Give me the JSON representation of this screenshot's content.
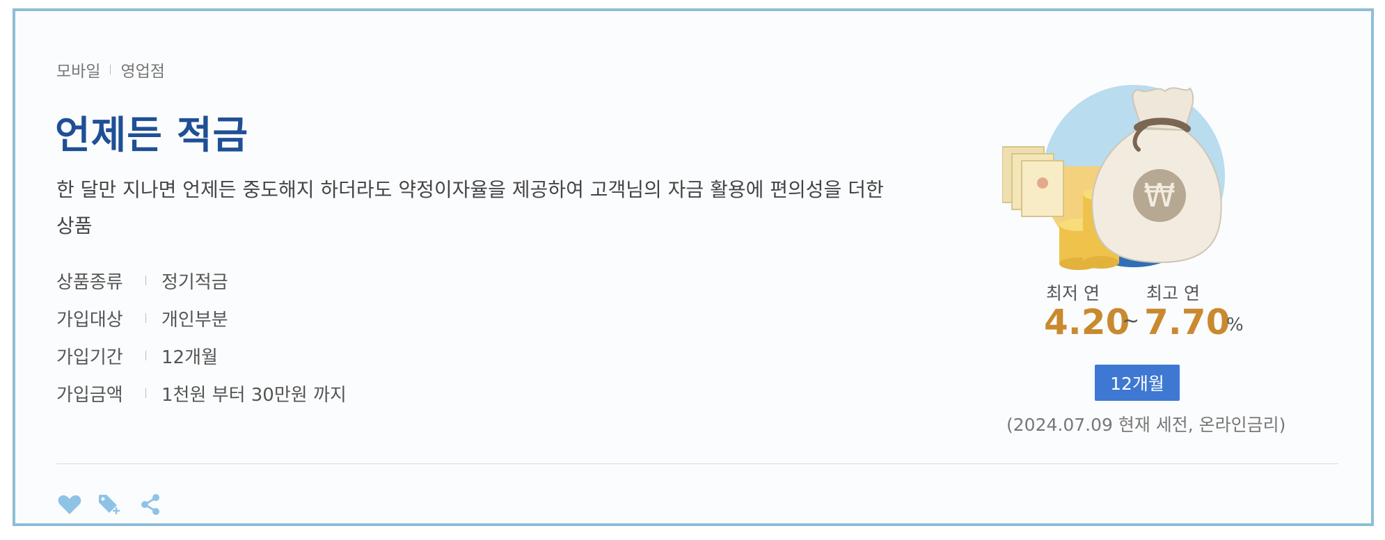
{
  "product": {
    "channels": [
      "모바일",
      "영업점"
    ],
    "title": "언제든 적금",
    "description": "한 달만 지나면 언제든 중도해지 하더라도 약정이자율을 제공하여 고객님의 자금 활용에 편의성을 더한 상품",
    "specs": [
      {
        "label": "상품종류",
        "value": "정기적금"
      },
      {
        "label": "가입대상",
        "value": "개인부분"
      },
      {
        "label": "가입기간",
        "value": "12개월"
      },
      {
        "label": "가입금액",
        "value": "1천원 부터 30만원 까지"
      }
    ]
  },
  "rates": {
    "min_label": "최저 연",
    "min_value": "4.20",
    "separator": "~",
    "max_label": "최고 연",
    "max_value": "7.70",
    "unit": "%",
    "term_badge": "12개월",
    "note": "(2024.07.09 현재 세전, 온라인금리)"
  },
  "actions": [
    {
      "icon": "heart-icon"
    },
    {
      "icon": "tag-add-icon"
    },
    {
      "icon": "share-icon"
    }
  ],
  "colors": {
    "title": "#1f4f95",
    "rate": "#c98a2f",
    "badge": "#3e78d2",
    "border": "#8fbdd6",
    "icon": "#8ec3e6"
  }
}
